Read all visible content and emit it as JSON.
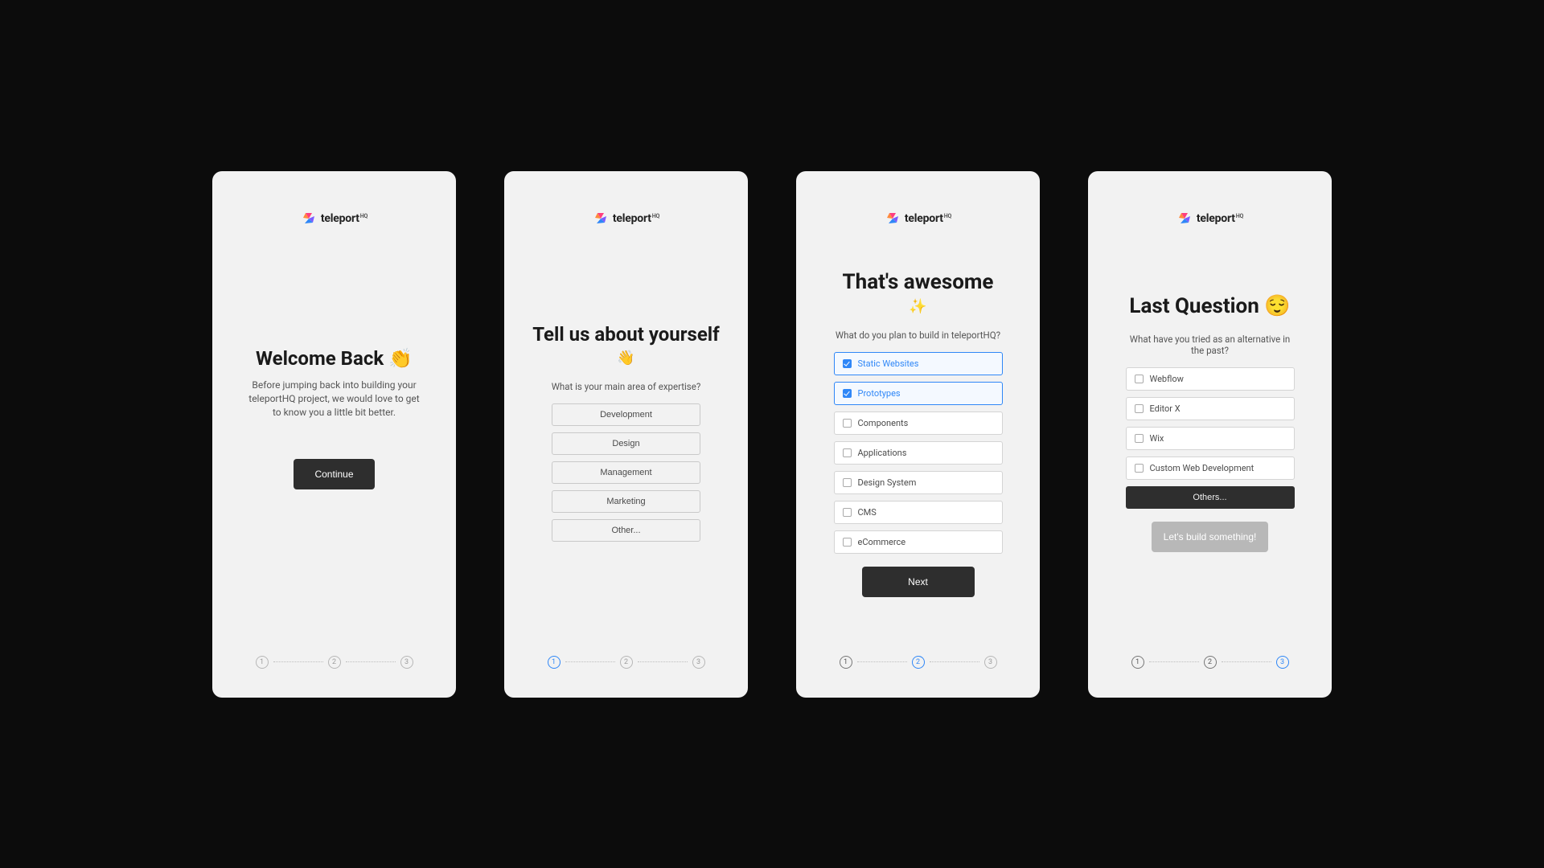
{
  "brand": {
    "name": "teleport",
    "suffix": "HQ"
  },
  "screens": [
    {
      "title": "Welcome Back 👏",
      "body": "Before jumping back into building your teleportHQ project, we would love to get to know you a little bit better.",
      "cta": "Continue",
      "steps": [
        "1",
        "2",
        "3"
      ],
      "activeStep": 0,
      "doneSteps": []
    },
    {
      "title": "Tell us about yourself",
      "emoji": "👋",
      "question": "What is your main area of expertise?",
      "options": [
        "Development",
        "Design",
        "Management",
        "Marketing",
        "Other..."
      ],
      "steps": [
        "1",
        "2",
        "3"
      ],
      "activeStep": 1,
      "doneSteps": []
    },
    {
      "title": "That's awesome",
      "emoji": "✨",
      "question": "What do you plan to build in teleportHQ?",
      "options": [
        {
          "label": "Static Websites",
          "selected": true
        },
        {
          "label": "Prototypes",
          "selected": true
        },
        {
          "label": "Components",
          "selected": false
        },
        {
          "label": "Applications",
          "selected": false
        },
        {
          "label": "Design System",
          "selected": false
        },
        {
          "label": "CMS",
          "selected": false
        },
        {
          "label": "eCommerce",
          "selected": false
        }
      ],
      "cta": "Next",
      "steps": [
        "1",
        "2",
        "3"
      ],
      "activeStep": 2,
      "doneSteps": [
        1
      ]
    },
    {
      "title": "Last Question 😌",
      "question": "What have you tried as an alternative in the past?",
      "options": [
        {
          "label": "Webflow",
          "selected": false
        },
        {
          "label": "Editor X",
          "selected": false
        },
        {
          "label": "Wix",
          "selected": false
        },
        {
          "label": "Custom Web Development",
          "selected": false
        }
      ],
      "extra": "Others...",
      "cta": "Let's build something!",
      "steps": [
        "1",
        "2",
        "3"
      ],
      "activeStep": 3,
      "doneSteps": [
        1,
        2
      ]
    }
  ]
}
